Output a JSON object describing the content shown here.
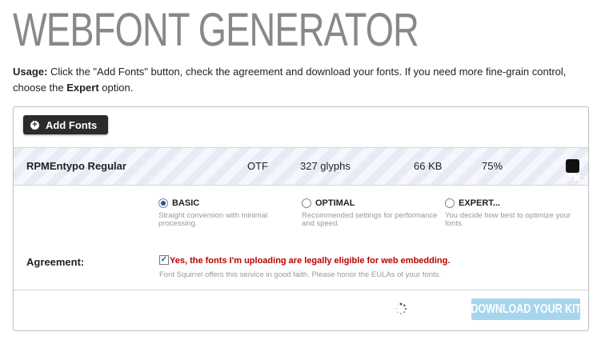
{
  "page": {
    "title": "WEBFONT GENERATOR",
    "usage": {
      "label": "Usage:",
      "text1": " Click the \"Add Fonts\" button, check the agreement and download your fonts. If you need more fine-grain control, choose the ",
      "expert": "Expert",
      "text2": " option."
    }
  },
  "toolbar": {
    "add_fonts_label": "Add Fonts",
    "add_icon": "plus-circle-icon"
  },
  "font_row": {
    "name": "RPMEntypo Regular",
    "type": "OTF",
    "glyphs": "327 glyphs",
    "size": "66 KB",
    "progress": "75%",
    "progress_value": 0.75,
    "remove_icon": "close-icon",
    "remove_glyph": "✖"
  },
  "options": [
    {
      "label": "BASIC",
      "desc": "Straight conversion with minimal processing.",
      "selected": true
    },
    {
      "label": "OPTIMAL",
      "desc": "Recommended settings for performance and speed.",
      "selected": false
    },
    {
      "label": "EXPERT...",
      "desc": "You decide how best to optimize your fonts.",
      "selected": false
    }
  ],
  "agreement": {
    "label": "Agreement:",
    "checked": true,
    "text": "Yes, the fonts I'm uploading are legally eligible for web embedding.",
    "note": "Font Squirrel offers this service in good faith. Please honor the EULAs of your fonts."
  },
  "download": {
    "label": "DOWNLOAD YOUR KIT",
    "enabled": false
  },
  "colors": {
    "title": "#888888",
    "agreement_text": "#bb0000",
    "download_bg": "#a6d6ee",
    "button_dark": "#2b2b2b",
    "row_stripe": "#e6ebf6"
  }
}
